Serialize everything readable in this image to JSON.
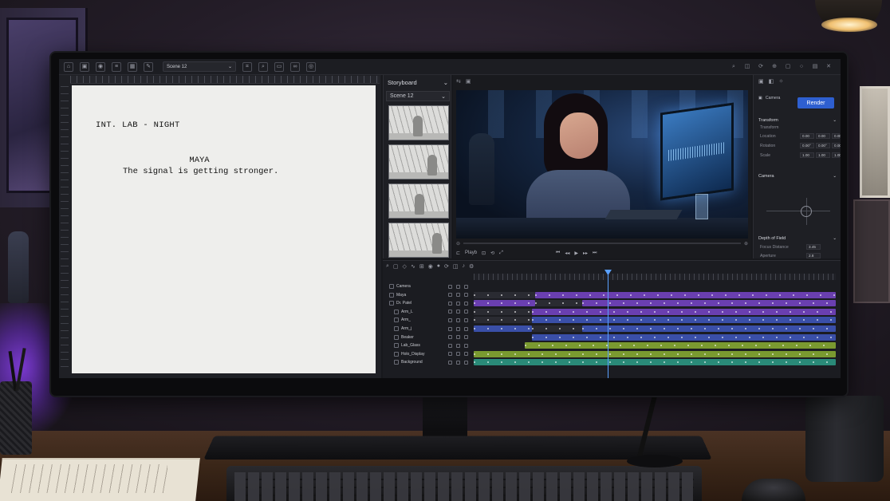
{
  "toolbar": {
    "scene_select": "Scene 12",
    "scene_select_chevron": "chevron-down-icon"
  },
  "script": {
    "scene_heading": "INT. LAB - NIGHT",
    "character": "MAYA",
    "dialogue": "The signal is getting stronger."
  },
  "storyboard": {
    "title": "Storyboard",
    "scene": "Scene 12"
  },
  "viewport": {
    "transport_label": "Playb"
  },
  "properties": {
    "camera_label": "Camera",
    "render_label": "Render",
    "transform": {
      "title": "Transform",
      "subtitle": "Transform",
      "rows": [
        {
          "label": "Location",
          "values": [
            "0.00",
            "0.00",
            "0.00"
          ]
        },
        {
          "label": "Rotation",
          "values": [
            "0.00°",
            "0.00°",
            "0.00°"
          ]
        },
        {
          "label": "Scale",
          "values": [
            "1.00",
            "1.00",
            "1.00"
          ]
        }
      ]
    },
    "camera_section_title": "Camera",
    "depth_of_field": {
      "title": "Depth of Field",
      "rows": [
        {
          "label": "Focus Distance",
          "value": "3.45"
        },
        {
          "label": "Aperture",
          "value": "2.8"
        }
      ]
    }
  },
  "timeline": {
    "tracks": [
      {
        "name": "Camera",
        "indent": 0
      },
      {
        "name": "Maya",
        "indent": 0
      },
      {
        "name": "Dr. Patel",
        "indent": 0
      },
      {
        "name": "Arm_L",
        "indent": 1
      },
      {
        "name": "Arm_",
        "indent": 1
      },
      {
        "name": "Arm_j",
        "indent": 1
      },
      {
        "name": "Beaker",
        "indent": 1
      },
      {
        "name": "Lab_Glass",
        "indent": 1
      },
      {
        "name": "Holo_Display",
        "indent": 1
      },
      {
        "name": "Background",
        "indent": 1
      }
    ],
    "playhead": 0.37,
    "colors": {
      "purple": "#6a3fb0",
      "blue": "#3a4fa8",
      "green": "#7a9a30",
      "teal": "#2a8a78",
      "dark": "#2a2b32",
      "playhead": "#5aa0ff"
    }
  },
  "accent": "#2e5fd0"
}
